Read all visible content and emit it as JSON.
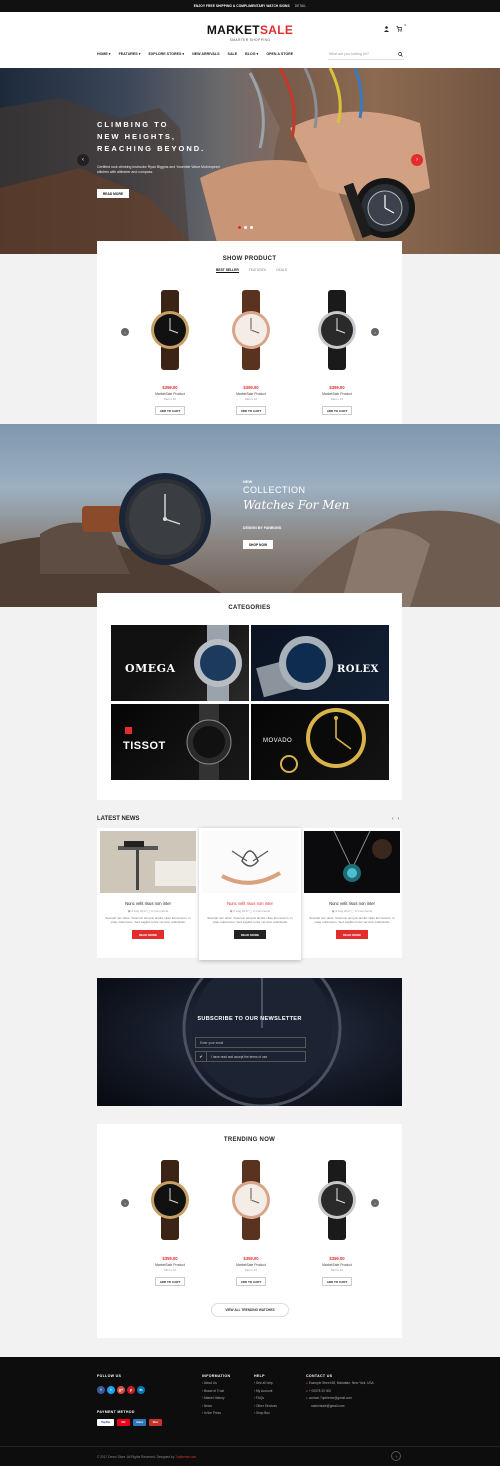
{
  "topbar": {
    "promo": "ENJOY FREE SHIPPING & COMPLIMENTARY WATCH SIGNS",
    "details": "DETAIL"
  },
  "header": {
    "logo_a": "MARKET",
    "logo_b": "SALE",
    "tagline": "SMARTER SHOPPING",
    "search_placeholder": "What are you looking for?",
    "cart_count": "0"
  },
  "nav": [
    "HOME ▾",
    "FEATURES ▾",
    "EXPLORE STORES ▾",
    "NEW ARRIVALS",
    "SALE",
    "BLOG ▾",
    "OPEN A STORE"
  ],
  "hero": {
    "title1": "CLIMBING TO",
    "title2": "NEW HEIGHTS,",
    "title3": "REACHING BEYOND.",
    "subtitle": "Certified rock climbing instructor Ryan Biggins and Yosemite Wave Motorspeed stitches with altimeter and compass.",
    "button": "READ MORE",
    "prev": "‹",
    "next": "›"
  },
  "show_product": {
    "title": "SHOW PRODUCT",
    "tabs": [
      "BEST SELLER",
      "FEATURED",
      "DEALS"
    ],
    "active_tab": 0,
    "products": [
      {
        "price": "$359.00",
        "name": "MarketSale Product",
        "brand": "Men's 12",
        "cta": "ADD TO CART",
        "dial": "#111111",
        "band": "#3b2416",
        "case": "#c9a063"
      },
      {
        "price": "$359.00",
        "name": "MarketSale Product",
        "brand": "Men's 12",
        "cta": "ADD TO CART",
        "dial": "#f3ede6",
        "band": "#5a3320",
        "case": "#d8a58a"
      },
      {
        "price": "$359.00",
        "name": "MarketSale Product",
        "brand": "Men's 12",
        "cta": "ADD TO CART",
        "dial": "#2a2a2a",
        "band": "#1a1a1a",
        "case": "#c7c9cc"
      }
    ]
  },
  "collection": {
    "new": "NEW",
    "collection": "COLLECTION",
    "script": "Watches For Men",
    "design": "DESIGN BY FANBONS",
    "button": "SHOP NOW"
  },
  "categories": {
    "title": "CATEGORIES",
    "items": [
      "OMEGA",
      "ROLEX",
      "TISSOT",
      "MOVADO"
    ]
  },
  "news": {
    "title": "LATEST NEWS",
    "items": [
      {
        "title": "Nunc velit risus non inter",
        "date": "6 Aug 2017",
        "comments": "0 Comments",
        "excerpt": "Suscipit nec dolor. Vivamus tempus iaculis vitae fermentum. In vitae nulla lacus. Sed sagittis tortor vel arcu sollicitudin",
        "button": "READ MORE"
      },
      {
        "title": "Nunc velit risus non inter",
        "date": "6 Aug 2017",
        "comments": "0 Comments",
        "excerpt": "Suscipit nec dolor. Vivamus tempus iaculis vitae fermentum. In vitae nulla lacus. Sed sagittis tortor vel arcu sollicitudin",
        "button": "READ MORE"
      },
      {
        "title": "Nunc velit risus non inter",
        "date": "6 Aug 2017",
        "comments": "0 Comments",
        "excerpt": "Suscipit nec dolor. Vivamus tempus iaculis vitae fermentum. In vitae nulla lacus. Sed sagittis tortor vel arcu sollicitudin",
        "button": "READ MORE"
      }
    ]
  },
  "newsletter": {
    "title": "SUBSCRIBE TO OUR NEWSLETTER",
    "placeholder": "Enter your email",
    "agree": "I have read and accept the terms of use"
  },
  "trending": {
    "title": "TRENDING NOW",
    "view_all": "VIEW ALL TRENDING WATCHES",
    "products": [
      {
        "price": "$359.00",
        "name": "MarketSale Product",
        "brand": "Men's 12",
        "cta": "ADD TO CART",
        "dial": "#111111",
        "band": "#3b2416",
        "case": "#c9a063"
      },
      {
        "price": "$359.00",
        "name": "MarketSale Product",
        "brand": "Men's 12",
        "cta": "ADD TO CART",
        "dial": "#f3ede6",
        "band": "#5a3320",
        "case": "#d8a58a"
      },
      {
        "price": "$359.00",
        "name": "MarketSale Product",
        "brand": "Men's 12",
        "cta": "ADD TO CART",
        "dial": "#2a2a2a",
        "band": "#1a1a1a",
        "case": "#c7c9cc"
      }
    ]
  },
  "footer": {
    "follow": "FOLLOW US",
    "payment": "PAYMENT METHOD",
    "social": [
      "f",
      "t",
      "g+",
      "p",
      "in"
    ],
    "pay": [
      "PayPal",
      "MC",
      "Amex",
      "Disc"
    ],
    "info_title": "INFORMATION",
    "info": [
      "› About Us",
      "› Brand of Trust",
      "› Market History",
      "› News",
      "› In the Press"
    ],
    "help_title": "HELP",
    "help": [
      "› See all help",
      "› My Account",
      "› FAQs",
      "› Other Services",
      "› Shop Box"
    ],
    "contact_title": "CONTACT US",
    "contact": [
      "Example Street 68, Mahattan, New York, USA",
      "+ 00578 30 300",
      "contact.7uptheme@gmail.com",
      "marketsale@gmail.com"
    ],
    "copyright": "© 2017 Demo Store. All Rights Reserved. Designed by",
    "designer": "7uptheme.com"
  },
  "colors": {
    "accent": "#e32d2d",
    "dark": "#111111"
  }
}
